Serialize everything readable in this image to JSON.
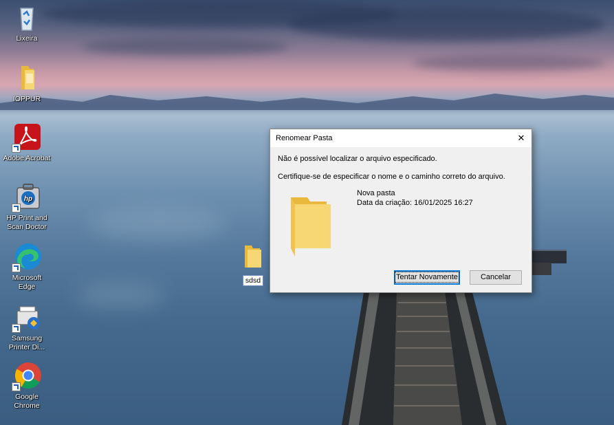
{
  "desktop_icons": [
    {
      "name": "Lixeira",
      "icon": "recycle-bin-icon"
    },
    {
      "name": "IOPPUR",
      "icon": "folder-icon"
    },
    {
      "name": "Adobe Acrobat",
      "icon": "adobe-acrobat-icon"
    },
    {
      "name": "HP Print and Scan Doctor",
      "icon": "hp-print-icon"
    },
    {
      "name": "Microsoft Edge",
      "icon": "edge-icon"
    },
    {
      "name": "Samsung Printer Di...",
      "icon": "samsung-printer-icon"
    },
    {
      "name": "Google Chrome",
      "icon": "chrome-icon"
    }
  ],
  "loose_folder": {
    "name": "sdsd",
    "icon": "folder-icon"
  },
  "dialog": {
    "title": "Renomear Pasta",
    "close_glyph": "✕",
    "message1": "Não é possível localizar o arquivo especificado.",
    "message2": "Certifique-se de especificar o nome e o caminho correto do arquivo.",
    "file_name": "Nova pasta",
    "file_created": "Data da criação: 16/01/2025 16:27",
    "retry_label": "Tentar Novamente",
    "cancel_label": "Cancelar"
  },
  "colors": {
    "dialog_bg": "#f0f0f0",
    "default_button_border": "#0078d7",
    "folder_yellow": "#f7d774"
  }
}
